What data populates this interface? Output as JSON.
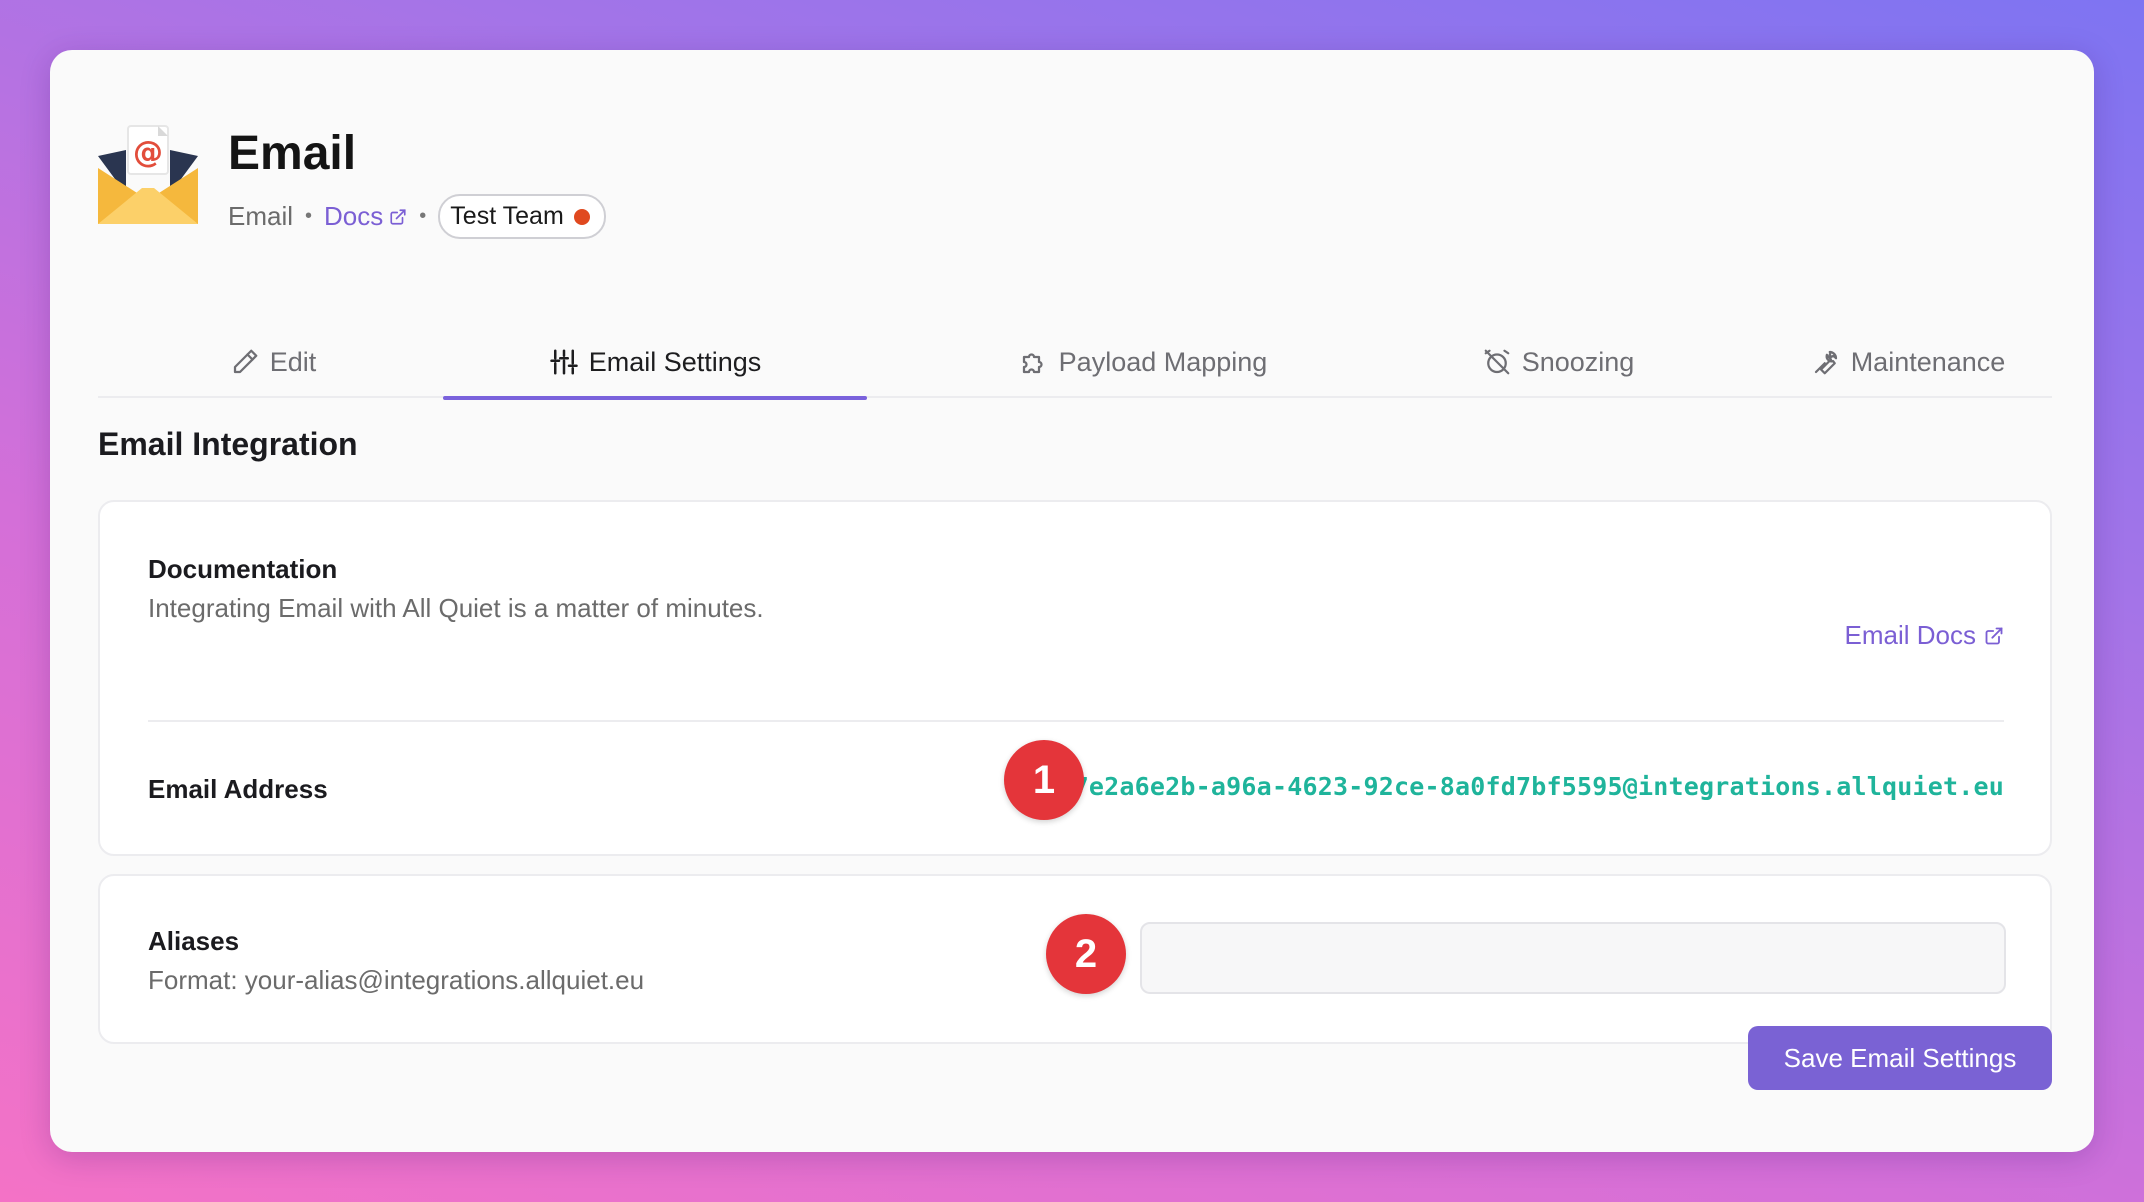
{
  "header": {
    "title": "Email",
    "type_label": "Email",
    "separator": "•",
    "docs_label": "Docs",
    "team_label": "Test Team",
    "team_status_color": "#e0491f"
  },
  "tabs": [
    {
      "label": "Edit",
      "icon": "pencil-icon",
      "active": false
    },
    {
      "label": "Email Settings",
      "icon": "sliders-icon",
      "active": true
    },
    {
      "label": "Payload Mapping",
      "icon": "puzzle-icon",
      "active": false
    },
    {
      "label": "Snoozing",
      "icon": "alarm-off-icon",
      "active": false
    },
    {
      "label": "Maintenance",
      "icon": "wrench-icon",
      "active": false
    }
  ],
  "section_title": "Email Integration",
  "documentation": {
    "label": "Documentation",
    "description": "Integrating Email with All Quiet is a matter of minutes.",
    "link_label": "Email Docs"
  },
  "email_address": {
    "label": "Email Address",
    "value": "7e2a6e2b-a96a-4623-92ce-8a0fd7bf5595@integrations.allquiet.eu"
  },
  "aliases": {
    "label": "Aliases",
    "format_hint": "Format: your-alias@integrations.allquiet.eu",
    "value": "",
    "placeholder": ""
  },
  "annotations": [
    "1",
    "2"
  ],
  "save_button": "Save Email Settings",
  "colors": {
    "accent": "#7a62d4",
    "link": "#7b5fd4",
    "email_value": "#1fb49b",
    "badge": "#e4353a"
  }
}
